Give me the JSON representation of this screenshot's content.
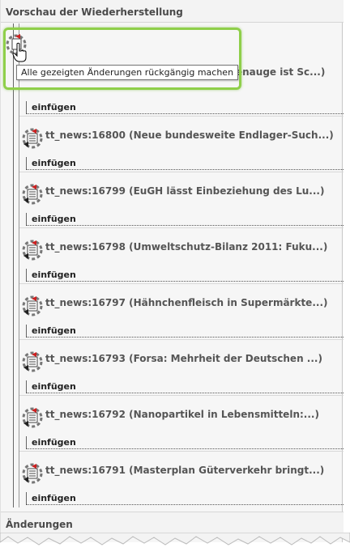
{
  "preview_header": "Vorschau der Wiederherstellung",
  "changes_header": "Änderungen",
  "tooltip": "Alle gezeigten Änderungen rückgängig machen",
  "root_title_fragment": "enauge ist Sc...)",
  "items": [
    {
      "title": "tt_news:16800 (Neue bundesweite Endlager-Such...)",
      "op": "einfügen"
    },
    {
      "title": "tt_news:16799 (EuGH lässt Einbeziehung des Lu...)",
      "op": "einfügen"
    },
    {
      "title": "tt_news:16798 (Umweltschutz-Bilanz 2011: Fuku...)",
      "op": "einfügen"
    },
    {
      "title": "tt_news:16797 (Hähnchenfleisch in Supermärkte...)",
      "op": "einfügen"
    },
    {
      "title": "tt_news:16793 (Forsa: Mehrheit der Deutschen ...)",
      "op": "einfügen"
    },
    {
      "title": "tt_news:16792 (Nanopartikel in Lebensmitteln:...)",
      "op": "einfügen"
    },
    {
      "title": "tt_news:16791 (Masterplan Güterverkehr bringt...)",
      "op": "einfügen"
    }
  ],
  "first_op": "einfügen",
  "colors": {
    "highlight": "#8fcf4a",
    "undo_arrow": "#cc1f1f"
  },
  "icons": {
    "root": "undo-page-icon",
    "item": "undo-record-icon",
    "cursor": "hand-cursor-icon"
  }
}
